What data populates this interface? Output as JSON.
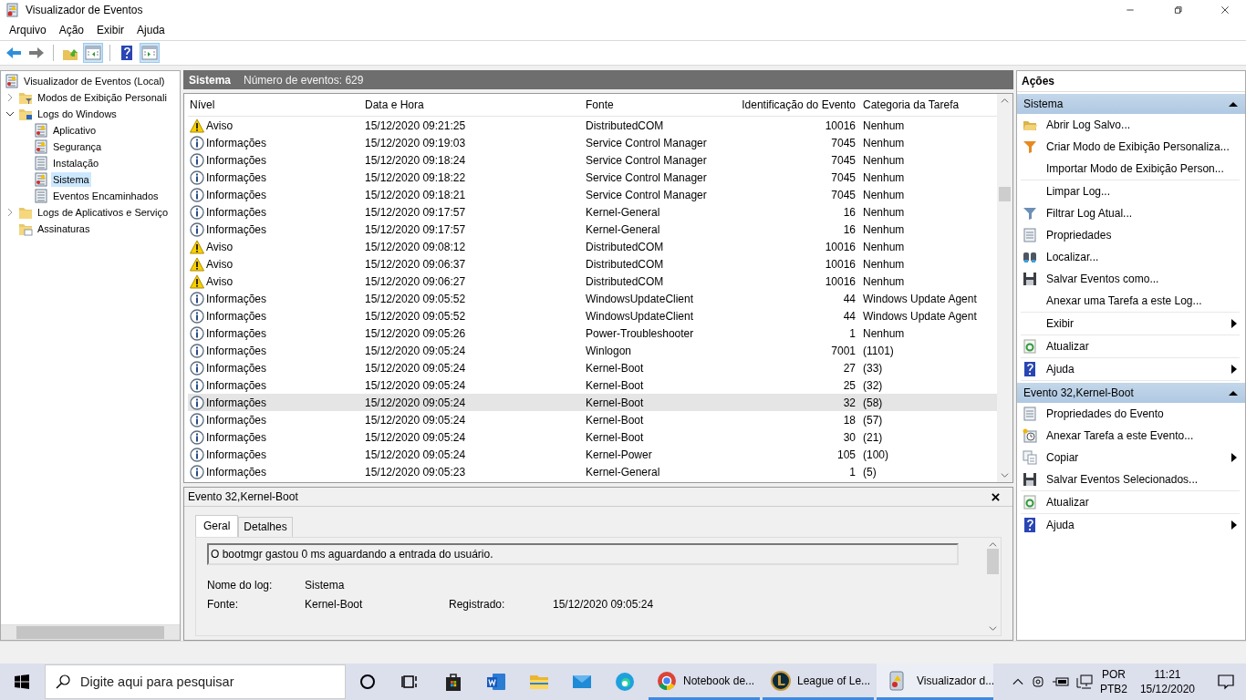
{
  "window": {
    "title": "Visualizador de Eventos"
  },
  "menu": [
    "Arquivo",
    "Ação",
    "Exibir",
    "Ajuda"
  ],
  "toolbar": [
    {
      "kind": "back",
      "pressed": false
    },
    {
      "kind": "forward",
      "pressed": false
    },
    {
      "kind": "up",
      "pressed": false
    },
    {
      "kind": "tree-toggle",
      "pressed": true
    },
    {
      "kind": "help",
      "pressed": false
    },
    {
      "kind": "actions-toggle",
      "pressed": true
    }
  ],
  "tree": [
    {
      "label": "Visualizador de Eventos (Local)",
      "kind": "viewer",
      "selected": false,
      "children": [
        {
          "label": "Modos de Exibição Personali",
          "kind": "filter-folder",
          "expanded": false,
          "selected": false
        },
        {
          "label": "Logs do Windows",
          "kind": "pc-folder",
          "expanded": true,
          "selected": false,
          "children": [
            {
              "label": "Aplicativo",
              "kind": "log-warn",
              "selected": false
            },
            {
              "label": "Segurança",
              "kind": "log-warn",
              "selected": false
            },
            {
              "label": "Instalação",
              "kind": "log",
              "selected": false
            },
            {
              "label": "Sistema",
              "kind": "log-warn",
              "selected": true
            },
            {
              "label": "Eventos Encaminhados",
              "kind": "log",
              "selected": false
            }
          ]
        },
        {
          "label": "Logs de Aplicativos e Serviço",
          "kind": "folder",
          "expanded": false,
          "selected": false
        },
        {
          "label": "Assinaturas",
          "kind": "sub-folder",
          "selected": false
        }
      ]
    }
  ],
  "events_header": {
    "log": "Sistema",
    "count": "Número de eventos: 629"
  },
  "table": {
    "columns": [
      "Nível",
      "Data e Hora",
      "Fonte",
      "Identificação do Evento",
      "Categoria da Tarefa"
    ],
    "rows": [
      {
        "kind": "warning",
        "level": "Aviso",
        "date": "15/12/2020 09:21:25",
        "source": "DistributedCOM",
        "id": "10016",
        "category": "Nenhum",
        "selected": false
      },
      {
        "kind": "info",
        "level": "Informações",
        "date": "15/12/2020 09:19:03",
        "source": "Service Control Manager",
        "id": "7045",
        "category": "Nenhum",
        "selected": false
      },
      {
        "kind": "info",
        "level": "Informações",
        "date": "15/12/2020 09:18:24",
        "source": "Service Control Manager",
        "id": "7045",
        "category": "Nenhum",
        "selected": false
      },
      {
        "kind": "info",
        "level": "Informações",
        "date": "15/12/2020 09:18:22",
        "source": "Service Control Manager",
        "id": "7045",
        "category": "Nenhum",
        "selected": false
      },
      {
        "kind": "info",
        "level": "Informações",
        "date": "15/12/2020 09:18:21",
        "source": "Service Control Manager",
        "id": "7045",
        "category": "Nenhum",
        "selected": false
      },
      {
        "kind": "info",
        "level": "Informações",
        "date": "15/12/2020 09:17:57",
        "source": "Kernel-General",
        "id": "16",
        "category": "Nenhum",
        "selected": false
      },
      {
        "kind": "info",
        "level": "Informações",
        "date": "15/12/2020 09:17:57",
        "source": "Kernel-General",
        "id": "16",
        "category": "Nenhum",
        "selected": false
      },
      {
        "kind": "warning",
        "level": "Aviso",
        "date": "15/12/2020 09:08:12",
        "source": "DistributedCOM",
        "id": "10016",
        "category": "Nenhum",
        "selected": false
      },
      {
        "kind": "warning",
        "level": "Aviso",
        "date": "15/12/2020 09:06:37",
        "source": "DistributedCOM",
        "id": "10016",
        "category": "Nenhum",
        "selected": false
      },
      {
        "kind": "warning",
        "level": "Aviso",
        "date": "15/12/2020 09:06:27",
        "source": "DistributedCOM",
        "id": "10016",
        "category": "Nenhum",
        "selected": false
      },
      {
        "kind": "info",
        "level": "Informações",
        "date": "15/12/2020 09:05:52",
        "source": "WindowsUpdateClient",
        "id": "44",
        "category": "Windows Update Agent",
        "selected": false
      },
      {
        "kind": "info",
        "level": "Informações",
        "date": "15/12/2020 09:05:52",
        "source": "WindowsUpdateClient",
        "id": "44",
        "category": "Windows Update Agent",
        "selected": false
      },
      {
        "kind": "info",
        "level": "Informações",
        "date": "15/12/2020 09:05:26",
        "source": "Power-Troubleshooter",
        "id": "1",
        "category": "Nenhum",
        "selected": false
      },
      {
        "kind": "info",
        "level": "Informações",
        "date": "15/12/2020 09:05:24",
        "source": "Winlogon",
        "id": "7001",
        "category": "(1101)",
        "selected": false
      },
      {
        "kind": "info",
        "level": "Informações",
        "date": "15/12/2020 09:05:24",
        "source": "Kernel-Boot",
        "id": "27",
        "category": "(33)",
        "selected": false
      },
      {
        "kind": "info",
        "level": "Informações",
        "date": "15/12/2020 09:05:24",
        "source": "Kernel-Boot",
        "id": "25",
        "category": "(32)",
        "selected": false
      },
      {
        "kind": "info",
        "level": "Informações",
        "date": "15/12/2020 09:05:24",
        "source": "Kernel-Boot",
        "id": "32",
        "category": "(58)",
        "selected": true
      },
      {
        "kind": "info",
        "level": "Informações",
        "date": "15/12/2020 09:05:24",
        "source": "Kernel-Boot",
        "id": "18",
        "category": "(57)",
        "selected": false
      },
      {
        "kind": "info",
        "level": "Informações",
        "date": "15/12/2020 09:05:24",
        "source": "Kernel-Boot",
        "id": "30",
        "category": "(21)",
        "selected": false
      },
      {
        "kind": "info",
        "level": "Informações",
        "date": "15/12/2020 09:05:24",
        "source": "Kernel-Power",
        "id": "105",
        "category": "(100)",
        "selected": false
      },
      {
        "kind": "info",
        "level": "Informações",
        "date": "15/12/2020 09:05:23",
        "source": "Kernel-General",
        "id": "1",
        "category": "(5)",
        "selected": false
      }
    ]
  },
  "details": {
    "title": "Evento 32,Kernel-Boot",
    "tabs": [
      {
        "label": "Geral",
        "selected": true
      },
      {
        "label": "Detalhes",
        "selected": false
      }
    ],
    "message": "O bootmgr gastou 0 ms aguardando a entrada do usuário.",
    "log_name_label": "Nome do log:",
    "log_name": "Sistema",
    "source_label": "Fonte:",
    "source": "Kernel-Boot",
    "logged_label": "Registrado:",
    "logged": "15/12/2020 09:05:24"
  },
  "actions": {
    "title": "Ações",
    "sections": [
      {
        "title": "Sistema",
        "groups": [
          [
            {
              "kind": "folder",
              "label": "Abrir Log Salvo...",
              "submenu": false
            },
            {
              "kind": "filter-color",
              "label": "Criar Modo de Exibição Personaliza...",
              "submenu": false
            },
            {
              "kind": "none",
              "label": "Importar Modo de Exibição Person...",
              "submenu": false
            }
          ],
          [
            {
              "kind": "none",
              "label": "Limpar Log...",
              "submenu": false
            },
            {
              "kind": "filter",
              "label": "Filtrar Log Atual...",
              "submenu": false
            },
            {
              "kind": "properties",
              "label": "Propriedades",
              "submenu": false
            },
            {
              "kind": "binoculars",
              "label": "Localizar...",
              "submenu": false
            },
            {
              "kind": "save",
              "label": "Salvar Eventos como...",
              "submenu": false
            },
            {
              "kind": "none",
              "label": "Anexar uma Tarefa a este Log...",
              "submenu": false
            }
          ],
          [
            {
              "kind": "none",
              "label": "Exibir",
              "submenu": true
            }
          ],
          [
            {
              "kind": "refresh",
              "label": "Atualizar",
              "submenu": false
            }
          ],
          [
            {
              "kind": "help",
              "label": "Ajuda",
              "submenu": true
            }
          ]
        ]
      },
      {
        "title": "Evento 32,Kernel-Boot",
        "groups": [
          [
            {
              "kind": "properties",
              "label": "Propriedades do Evento",
              "submenu": false
            },
            {
              "kind": "task",
              "label": "Anexar Tarefa a este Evento...",
              "submenu": false
            },
            {
              "kind": "copy",
              "label": "Copiar",
              "submenu": true
            },
            {
              "kind": "save",
              "label": "Salvar Eventos Selecionados...",
              "submenu": false
            }
          ],
          [
            {
              "kind": "refresh",
              "label": "Atualizar",
              "submenu": false
            }
          ],
          [
            {
              "kind": "help",
              "label": "Ajuda",
              "submenu": true
            }
          ]
        ]
      }
    ]
  },
  "taskbar": {
    "search_placeholder": "Digite aqui para pesquisar",
    "pinned": [
      {
        "kind": "cortana"
      },
      {
        "kind": "task-view"
      },
      {
        "kind": "store"
      },
      {
        "kind": "word"
      },
      {
        "kind": "explorer"
      },
      {
        "kind": "mail"
      },
      {
        "kind": "edge"
      }
    ],
    "apps": [
      {
        "kind": "chrome",
        "label": "Notebook de...",
        "active": false
      },
      {
        "kind": "league",
        "label": "League of Le...",
        "active": false
      },
      {
        "kind": "viewer",
        "label": "Visualizador d...",
        "active": true
      }
    ],
    "language": "POR",
    "layout": "PTB2",
    "time": "11:21",
    "date": "15/12/2020"
  }
}
